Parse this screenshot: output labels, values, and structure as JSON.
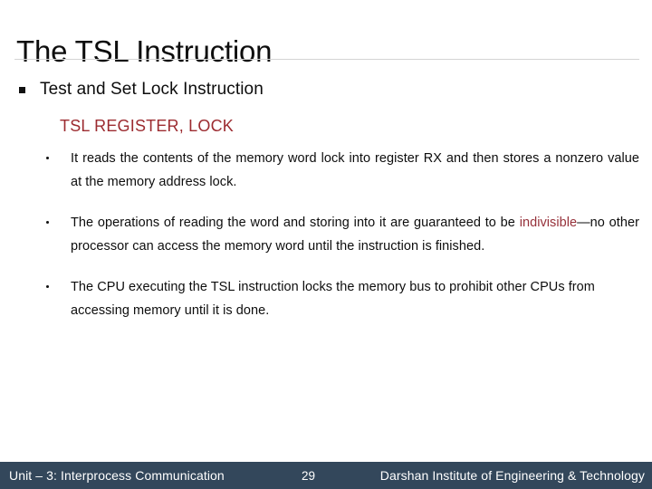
{
  "slide": {
    "title": "The TSL Instruction",
    "level1_bullet": {
      "marker": "square-bullet-icon",
      "text": "Test and Set Lock Instruction"
    },
    "red_heading": "TSL REGISTER, LOCK",
    "bullets": [
      {
        "marker": "dot-bullet-icon",
        "text": "It reads the contents of the memory word lock into register RX and then stores a nonzero value at the memory address lock."
      },
      {
        "marker": "dot-bullet-icon",
        "segments": {
          "lead": "The operations of reading the word and storing into it are guaranteed to be ",
          "accent": "indivisible",
          "tail": "—no other processor can access the memory word until the instruction is finished."
        }
      },
      {
        "marker": "dot-bullet-icon",
        "text": "The CPU executing the TSL instruction locks the memory bus to prohibit other CPUs from accessing memory until it is done."
      }
    ]
  },
  "footer": {
    "left": "Unit – 3: Interprocess Communication",
    "page_number": "29",
    "right": "Darshan Institute of Engineering & Technology",
    "background_color": "#33475b",
    "text_color": "#ffffff"
  },
  "colors": {
    "accent_red": "#9c2b30",
    "body_text": "#0d0d0d",
    "rule": "#d4d4d4",
    "slide_background": "#ffffff"
  }
}
